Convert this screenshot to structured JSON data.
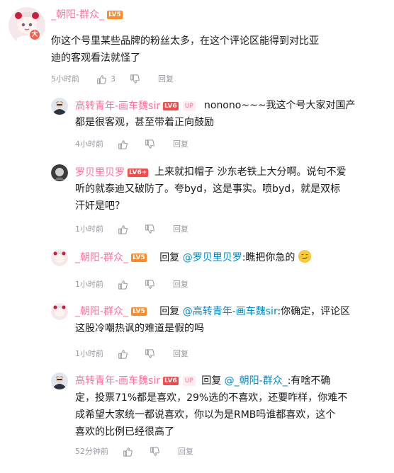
{
  "main_comment": {
    "username": "_朝阳-群众_",
    "level": "LV5",
    "avatar_badge": "大",
    "lines": [
      "你这个号里某些品牌的粉丝太多，在这个评论区能得到对比亚",
      "迪的客观看法就怪了"
    ],
    "time": "5小时前",
    "likes": "3",
    "reply_label": "回复"
  },
  "replies": [
    {
      "username": "高转青年-画车魏sir",
      "level": "LV6",
      "up_badge": "UP",
      "lines": [
        "nonono~~~我这个号大家对国产",
        "都是很客观，甚至带着正向鼓励"
      ],
      "time": "4小时前",
      "reply_label": "回复"
    },
    {
      "username": "罗贝里贝罗",
      "level": "LV6+",
      "lines": [
        "上来就扣帽子 沙东老铁上大分啊。说句不爱",
        "听的就泰迪又破防了。夸byd，这是事实。喷byd，就是双标",
        "汗奸是吧？"
      ],
      "time": "1小时前",
      "reply_label": "回复"
    },
    {
      "username": "_朝阳-群众_",
      "level": "LV5",
      "reply_prefix": "回复",
      "mention": "@罗贝里贝罗",
      "text": ":瞧把你急的",
      "time": "1小时前",
      "reply_label": "回复"
    },
    {
      "username": "_朝阳-群众_",
      "level": "LV5",
      "reply_prefix": "回复",
      "mention": "@高转青年-画车魏sir",
      "text": ":你确定，评论区",
      "line2": "这股冷嘲热讽的难道是假的吗",
      "time": "1小时前",
      "reply_label": "回复"
    },
    {
      "username": "高转青年-画车魏sir",
      "level": "LV6",
      "up_badge": "UP",
      "reply_prefix": "回复",
      "mention": "@_朝阳-群众_",
      "text": ":有啥不确",
      "lines": [
        "定，投票71%都是喜欢，29%选的不喜欢，还要咋样，你难不",
        "成希望大家统一都说喜欢，你以为是RMB吗谁都喜欢，这个",
        "喜欢的比例已经很高了"
      ],
      "time": "52分钟前",
      "reply_label": "回复"
    }
  ],
  "colors": {
    "name_pink": "#fb7299",
    "mention_blue": "#008ac5",
    "meta_gray": "#9499a0",
    "level_orange": "#ff8a2b"
  }
}
